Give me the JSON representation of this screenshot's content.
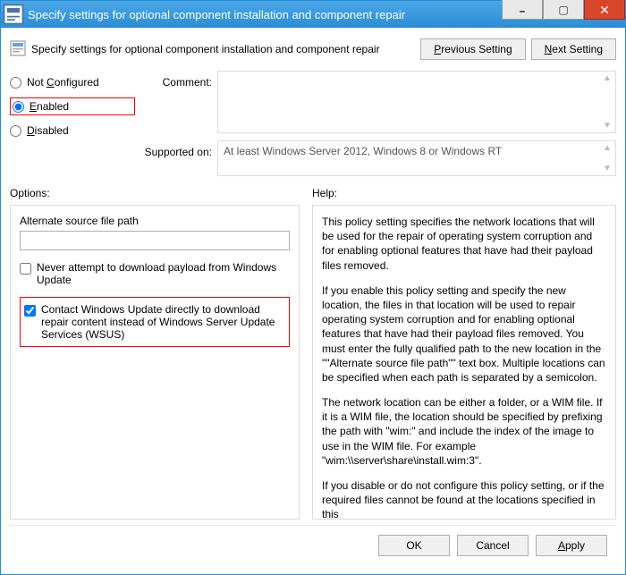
{
  "window": {
    "title": "Specify settings for optional component installation and component repair"
  },
  "header": {
    "description": "Specify settings for optional component installation and component repair",
    "prev_p": "P",
    "prev_rest": "revious Setting",
    "next_n": "N",
    "next_rest": "ext Setting"
  },
  "state": {
    "not_configured_N": "Not ",
    "not_configured_C": "C",
    "not_configured_rest": "onfigured",
    "enabled_E": "E",
    "enabled_rest": "nabled",
    "disabled_D": "D",
    "disabled_rest": "isabled",
    "selected": "enabled"
  },
  "labels": {
    "comment": "Comment:",
    "supported_on": "Supported on:",
    "options": "Options:",
    "help": "Help:"
  },
  "supported_on_text": "At least Windows Server 2012, Windows 8 or Windows RT",
  "options_panel": {
    "alt_path_label": "Alternate source file path",
    "alt_path_value": "",
    "never_download_label": "Never attempt to download payload from Windows Update",
    "never_download_checked": false,
    "contact_wu_label": "Contact Windows Update directly to download repair content instead of Windows Server Update Services (WSUS)",
    "contact_wu_checked": true
  },
  "help_text": {
    "p1": "This policy setting specifies the network locations that will be used for the repair of operating system corruption and for enabling optional features that have had their payload files removed.",
    "p2": "If you enable this policy setting and specify the new location, the files in that location will be used to repair operating system corruption and for enabling optional features that have had their payload files removed. You must enter the fully qualified path to the new location in the \"\"Alternate source file path\"\" text box. Multiple locations can be specified when each path is separated by a semicolon.",
    "p3": "The network location can be either a folder, or a WIM file. If it is a WIM file, the location should be specified by prefixing the path with \"wim:\" and include the index of the image to use in the WIM file. For example \"wim:\\\\server\\share\\install.wim:3\".",
    "p4": "If you disable or do not configure this policy setting, or if the required files cannot be found at the locations specified in this"
  },
  "footer": {
    "ok": "OK",
    "cancel": "Cancel",
    "apply_a": "A",
    "apply_rest": "pply"
  }
}
